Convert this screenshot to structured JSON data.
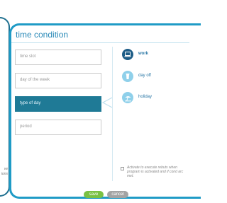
{
  "left_panel": {
    "text": "ve\nions"
  },
  "title": "time condition",
  "fields": [
    {
      "label": "time slot"
    },
    {
      "label": "day of the week"
    },
    {
      "label": "type of day"
    },
    {
      "label": "period"
    }
  ],
  "options": [
    {
      "label": "work",
      "icon": "work-icon"
    },
    {
      "label": "day off",
      "icon": "day-off-icon"
    },
    {
      "label": "holiday",
      "icon": "holiday-icon"
    }
  ],
  "note": "Activate to execute rebuts when program is activated and if cond arc met.",
  "buttons": {
    "save": "save",
    "cancel": "cancel"
  }
}
